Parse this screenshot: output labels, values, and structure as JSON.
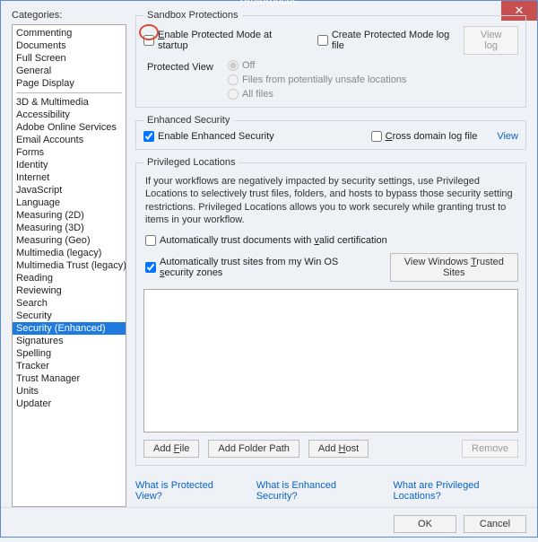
{
  "window": {
    "title": "Preferences"
  },
  "sidebar": {
    "label": "Categories:",
    "group1": [
      "Commenting",
      "Documents",
      "Full Screen",
      "General",
      "Page Display"
    ],
    "group2": [
      "3D & Multimedia",
      "Accessibility",
      "Adobe Online Services",
      "Email Accounts",
      "Forms",
      "Identity",
      "Internet",
      "JavaScript",
      "Language",
      "Measuring (2D)",
      "Measuring (3D)",
      "Measuring (Geo)",
      "Multimedia (legacy)",
      "Multimedia Trust (legacy)",
      "Reading",
      "Reviewing",
      "Search",
      "Security",
      "Security (Enhanced)",
      "Signatures",
      "Spelling",
      "Tracker",
      "Trust Manager",
      "Units",
      "Updater"
    ],
    "selected": "Security (Enhanced)"
  },
  "sandbox": {
    "legend": "Sandbox Protections",
    "enable_pre": "",
    "enable_mid": "E",
    "enable_post": "nable Protected Mode at startup",
    "createlog": "Create Protected Mode log file",
    "viewlog": "View log",
    "pv_label": "Protected View",
    "pv_off": "Off",
    "pv_unsafe": "Files from potentially unsafe locations",
    "pv_all": "All files"
  },
  "enhanced": {
    "legend": "Enhanced Security",
    "enable": "Enable Enhanced Security",
    "cross_pre": "",
    "cross_u": "C",
    "cross_post": "ross domain log file",
    "view": "View"
  },
  "priv": {
    "legend": "Privileged Locations",
    "desc": "If your workflows are negatively impacted by security settings, use Privileged Locations to selectively trust files, folders, and hosts to bypass those security setting restrictions. Privileged Locations allows you to work securely while granting trust to items in your workflow.",
    "autodoc_pre": "Automatically trust documents with ",
    "autodoc_u": "v",
    "autodoc_post": "alid certification",
    "autozone_pre": "Automatically trust sites from my Win OS ",
    "autozone_u": "s",
    "autozone_post": "ecurity zones",
    "btn_trusted_pre": "View Windows ",
    "btn_trusted_u": "T",
    "btn_trusted_post": "rusted Sites",
    "btn_addfile_pre": "Add ",
    "btn_addfile_u": "F",
    "btn_addfile_post": "ile",
    "btn_addfolder": "Add Folder Path",
    "btn_addhost_pre": "Add ",
    "btn_addhost_u": "H",
    "btn_addhost_post": "ost",
    "btn_remove": "Remove"
  },
  "help": {
    "pv": "What is Protected View?",
    "es": "What is Enhanced Security?",
    "pl": "What are Privileged Locations?"
  },
  "footer": {
    "ok": "OK",
    "cancel": "Cancel"
  }
}
